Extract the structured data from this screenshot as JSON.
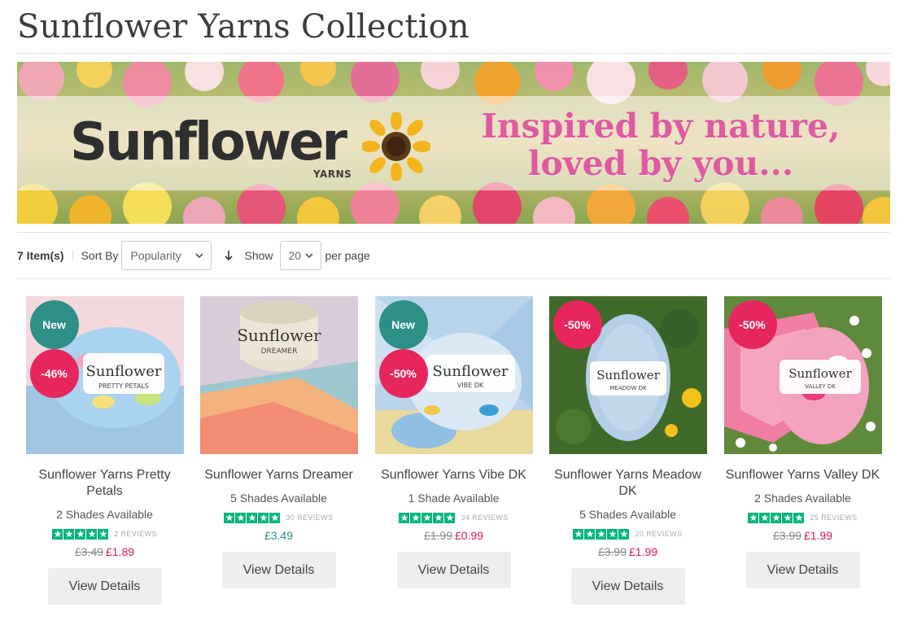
{
  "page": {
    "title": "Sunflower Yarns Collection"
  },
  "banner": {
    "brand": "Sunflower",
    "brand_sub": "YARNS",
    "tagline_1": "Inspired by nature,",
    "tagline_2": "loved by you..."
  },
  "toolbar": {
    "item_count": "7 Item(s)",
    "sort_label": "Sort By",
    "sort_value": "Popularity",
    "show_label": "Show",
    "show_value": "20",
    "per_page_label": "per page"
  },
  "products": [
    {
      "name": "Sunflower Yarns Pretty Petals",
      "shades": "2 Shades Available",
      "reviews": "2 REVIEWS",
      "rating": 5,
      "badge_new": "New",
      "badge_sale": "-46%",
      "was_price": "£3.49",
      "price": "£1.89",
      "button": "View Details",
      "label_text": "Sunflower",
      "label_sub": "PRETTY PETALS"
    },
    {
      "name": "Sunflower Yarns Dreamer",
      "shades": "5 Shades Available",
      "reviews": "30 REVIEWS",
      "rating": 5,
      "badge_new": "",
      "badge_sale": "",
      "was_price": "",
      "price": "£3.49",
      "button": "View Details",
      "label_text": "Sunflower",
      "label_sub": "DREAMER"
    },
    {
      "name": "Sunflower Yarns Vibe DK",
      "shades": "1 Shade Available",
      "reviews": "34 REVIEWS",
      "rating": 5,
      "badge_new": "New",
      "badge_sale": "-50%",
      "was_price": "£1.99",
      "price": "£0.99",
      "button": "View Details",
      "label_text": "Sunflower",
      "label_sub": "VIBE DK"
    },
    {
      "name": "Sunflower Yarns Meadow DK",
      "shades": "5 Shades Available",
      "reviews": "20 REVIEWS",
      "rating": 5,
      "badge_new": "",
      "badge_sale": "-50%",
      "was_price": "£3.99",
      "price": "£1.99",
      "button": "View Details",
      "label_text": "Sunflower",
      "label_sub": "MEADOW DK"
    },
    {
      "name": "Sunflower Yarns Valley DK",
      "shades": "2 Shades Available",
      "reviews": "25 REVIEWS",
      "rating": 5,
      "badge_new": "",
      "badge_sale": "-50%",
      "was_price": "£3.99",
      "price": "£1.99",
      "button": "View Details",
      "label_text": "Sunflower",
      "label_sub": "VALLEY DK"
    }
  ],
  "colors": {
    "badge_new": "#2d8f86",
    "badge_sale": "#e8265e",
    "sale_price": "#d81b4f",
    "regular_price": "#2d8f86",
    "trustpilot_green": "#00b67a",
    "tagline_pink": "#e05aa0"
  },
  "icons": {
    "sort_direction": "arrow-down-icon",
    "select_caret": "chevron-down-icon",
    "rating_star": "star-icon"
  }
}
